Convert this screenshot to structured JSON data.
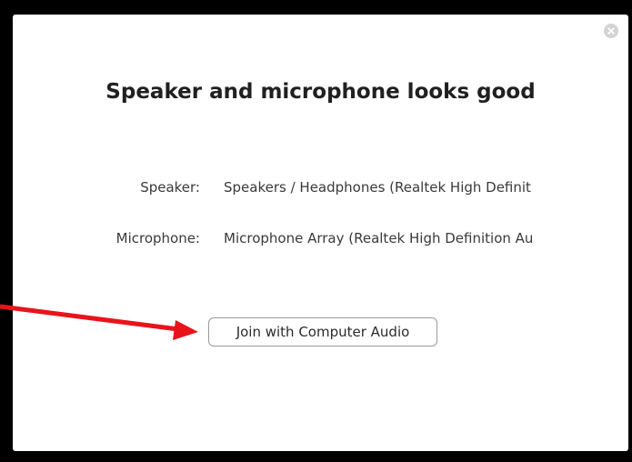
{
  "dialog": {
    "title": "Speaker and microphone looks good",
    "close_icon": "close-icon",
    "speaker": {
      "label": "Speaker:",
      "value": "Speakers / Headphones (Realtek High Definit"
    },
    "microphone": {
      "label": "Microphone:",
      "value": "Microphone Array (Realtek High Definition Au"
    },
    "join_button_label": "Join with Computer Audio"
  },
  "annotation": {
    "arrow_color": "#e8141b",
    "arrow_icon": "red-arrow-icon"
  },
  "colors": {
    "frame": "#000000",
    "dialog_bg": "#ffffff",
    "close_button": "#d3d3d6"
  }
}
